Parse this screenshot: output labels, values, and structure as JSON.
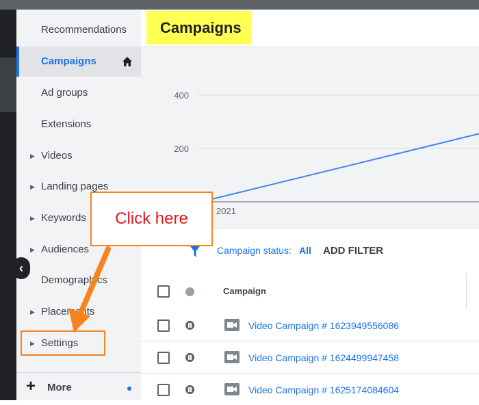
{
  "page": {
    "title": "Campaigns"
  },
  "sidebar": {
    "items": [
      {
        "label": "Recommendations",
        "caret": false,
        "active": false
      },
      {
        "label": "Campaigns",
        "caret": false,
        "active": true
      },
      {
        "label": "Ad groups",
        "caret": false,
        "active": false
      },
      {
        "label": "Extensions",
        "caret": false,
        "active": false
      },
      {
        "label": "Videos",
        "caret": true,
        "active": false
      },
      {
        "label": "Landing pages",
        "caret": true,
        "active": false
      },
      {
        "label": "Keywords",
        "caret": true,
        "active": false
      },
      {
        "label": "Audiences",
        "caret": true,
        "active": false
      },
      {
        "label": "Demographics",
        "caret": false,
        "active": false
      },
      {
        "label": "Placements",
        "caret": true,
        "active": false
      },
      {
        "label": "Settings",
        "caret": true,
        "active": false
      }
    ],
    "more_label": "More"
  },
  "chart_data": {
    "type": "line",
    "y_ticks": [
      "400",
      "200"
    ],
    "x_tick_labels": [
      "2021"
    ],
    "series": [
      {
        "color": "#4285f4",
        "points": [
          {
            "x": "2021",
            "y": 0
          },
          {
            "x": null,
            "y": 250
          }
        ]
      }
    ]
  },
  "filter": {
    "status_label": "Campaign status:",
    "status_value": "All",
    "add_filter": "ADD FILTER"
  },
  "table": {
    "column_campaign": "Campaign",
    "rows": [
      {
        "name": "Video Campaign # 1623949556086"
      },
      {
        "name": "Video Campaign # 1624499947458"
      },
      {
        "name": "Video Campaign # 1625174084604"
      }
    ]
  },
  "annotation": {
    "callout": "Click here",
    "color": "#f5841f"
  },
  "colors": {
    "accent": "#1a73e8",
    "highlight": "#ffff54"
  }
}
